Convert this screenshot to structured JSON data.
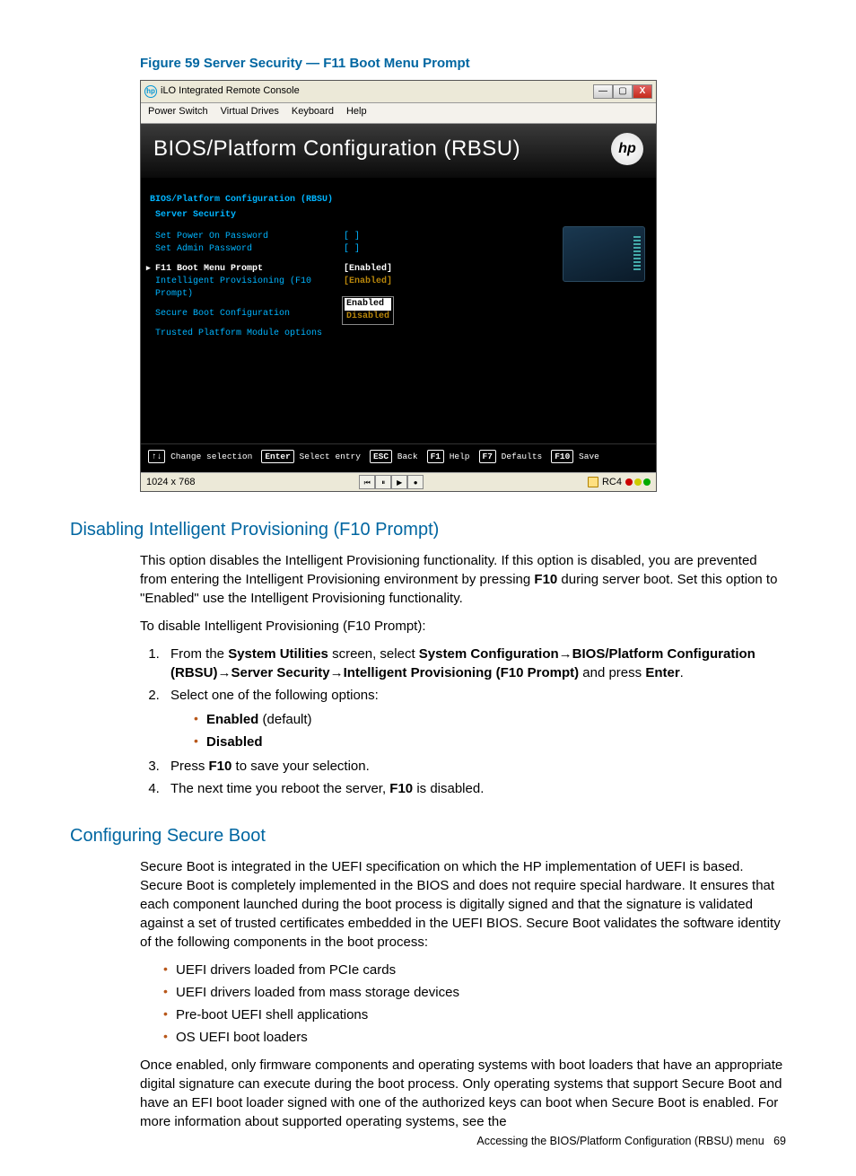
{
  "figure": {
    "caption": "Figure 59 Server Security — F11 Boot Menu Prompt"
  },
  "window": {
    "title": "iLO Integrated Remote Console",
    "menus": [
      "Power Switch",
      "Virtual Drives",
      "Keyboard",
      "Help"
    ],
    "min": "—",
    "max": "▢",
    "close": "X"
  },
  "bios": {
    "banner": "BIOS/Platform Configuration (RBSU)",
    "logo": "hp",
    "crumb1": "BIOS/Platform Configuration (RBSU)",
    "crumb2": "Server Security",
    "rows": [
      {
        "label": "Set Power On Password",
        "value": "[        ]"
      },
      {
        "label": "Set Admin Password",
        "value": "[        ]"
      },
      {
        "label": "F11 Boot Menu Prompt",
        "value": "[Enabled]",
        "current": true
      },
      {
        "label": "Intelligent Provisioning (F10 Prompt)",
        "value": "[Enabled]"
      },
      {
        "label": "Secure Boot Configuration",
        "value": ""
      },
      {
        "label": "Trusted Platform Module options",
        "value": ""
      }
    ],
    "dropdown": [
      "Enabled",
      "Disabled"
    ],
    "keys": [
      {
        "k": "↑↓",
        "t": "Change selection"
      },
      {
        "k": "Enter",
        "t": "Select entry"
      },
      {
        "k": "ESC",
        "t": "Back"
      },
      {
        "k": "F1",
        "t": "Help"
      },
      {
        "k": "F7",
        "t": "Defaults"
      },
      {
        "k": "F10",
        "t": "Save"
      }
    ]
  },
  "statusbar": {
    "res": "1024 x 768",
    "enc": "RC4"
  },
  "section1": {
    "heading": "Disabling Intelligent Provisioning (F10 Prompt)",
    "para1a": "This option disables the Intelligent Provisioning functionality. If this option is disabled, you are prevented from entering the Intelligent Provisioning environment by pressing ",
    "para1b": " during server boot. Set this option to \"Enabled\" use the Intelligent Provisioning functionality.",
    "f10": "F10",
    "para2": "To disable Intelligent Provisioning (F10 Prompt):",
    "step1_a": "From the ",
    "step1_b": "System Utilities",
    "step1_c": " screen, select ",
    "step1_d": "System Configuration",
    "step1_e": "BIOS/Platform Configuration (RBSU)",
    "step1_f": "Server Security",
    "step1_g": "Intelligent Provisioning (F10 Prompt)",
    "step1_h": " and press ",
    "step1_i": "Enter",
    "step1_j": ".",
    "step2": "Select one of the following options:",
    "opt1a": "Enabled",
    "opt1b": " (default)",
    "opt2": "Disabled",
    "step3a": "Press ",
    "step3b": "F10",
    "step3c": " to save your selection.",
    "step4a": "The next time you reboot the server, ",
    "step4b": "F10",
    "step4c": " is disabled."
  },
  "section2": {
    "heading": "Configuring Secure Boot",
    "para1": "Secure Boot is integrated in the UEFI specification on which the HP implementation of UEFI is based. Secure Boot is completely implemented in the BIOS and does not require special hardware. It ensures that each component launched during the boot process is digitally signed and that the signature is validated against a set of trusted certificates embedded in the UEFI BIOS. Secure Boot validates the software identity of the following components in the boot process:",
    "bullets": [
      "UEFI drivers loaded from PCIe cards",
      "UEFI drivers loaded from mass storage devices",
      "Pre-boot UEFI shell applications",
      "OS UEFI boot loaders"
    ],
    "para2": "Once enabled, only firmware components and operating systems with boot loaders that have an appropriate digital signature can execute during the boot process. Only operating systems that support Secure Boot and have an EFI boot loader signed with one of the authorized keys can boot when Secure Boot is enabled. For more information about supported operating systems, see the"
  },
  "footer": {
    "text": "Accessing the BIOS/Platform Configuration (RBSU) menu",
    "page": "69"
  }
}
